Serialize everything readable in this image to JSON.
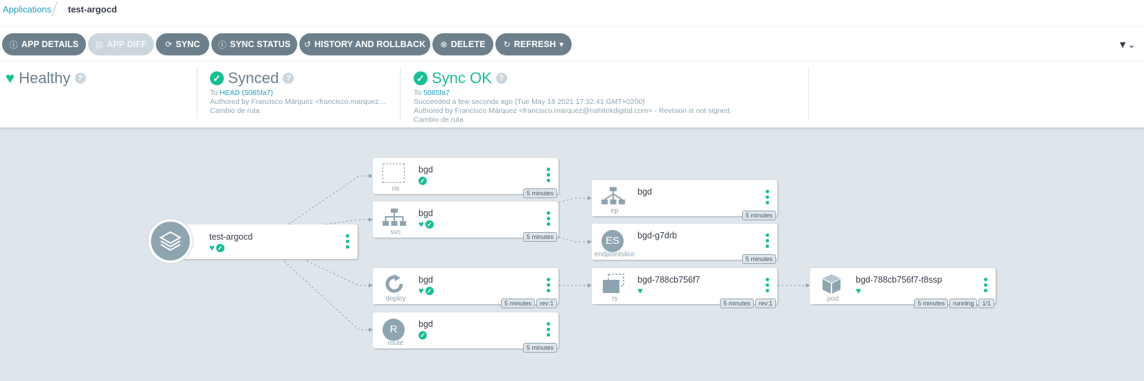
{
  "breadcrumb": {
    "root": "Applications",
    "current": "test-argocd"
  },
  "toolbar": {
    "app_details": "APP DETAILS",
    "app_diff": "APP DIFF",
    "sync": "SYNC",
    "sync_status": "SYNC STATUS",
    "history": "HISTORY AND ROLLBACK",
    "delete": "DELETE",
    "refresh": "REFRESH"
  },
  "health": {
    "title": "Healthy"
  },
  "sync": {
    "title": "Synced",
    "to_prefix": "To",
    "to_rev": "HEAD (5085fa7)",
    "author": "Authored by Francisco Márquez <francisco.marquez…",
    "message": "Cambio de ruta"
  },
  "operation": {
    "title": "Sync OK",
    "to_prefix": "To",
    "to_rev": "5085fa7",
    "succeeded": "Succeeded a few seconds ago (Tue May 18 2021 17:32:41 GMT+0200)",
    "author": "Authored by Francisco Márquez <francisco.marquez@nahitekdigital.com> - Revision is not signed.",
    "message": "Cambio de ruta"
  },
  "colors": {
    "accent": "#18be94",
    "button": "#6d7f8b",
    "button_disabled": "#ccd6dd",
    "graph_bg": "#dee6eb",
    "link": "#1a9fc0"
  },
  "graph": {
    "app": {
      "name": "test-argocd"
    },
    "ns": {
      "name": "bgd",
      "kind": "ns",
      "age": "5 minutes"
    },
    "svc": {
      "name": "bgd",
      "kind": "svc",
      "age": "5 minutes"
    },
    "deploy": {
      "name": "bgd",
      "kind": "deploy",
      "age": "5 minutes",
      "rev": "rev:1"
    },
    "route": {
      "name": "bgd",
      "kind": "route",
      "age": "5 minutes",
      "badge": "R"
    },
    "ep": {
      "name": "bgd",
      "kind": "ep",
      "age": "5 minutes"
    },
    "es": {
      "name": "bgd-g7drb",
      "kind": "endpointslice",
      "age": "5 minutes",
      "badge": "ES"
    },
    "rs": {
      "name": "bgd-788cb756f7",
      "kind": "rs",
      "age": "5 minutes",
      "rev": "rev:1"
    },
    "pod": {
      "name": "bgd-788cb756f7-t8ssp",
      "kind": "pod",
      "age": "5 minutes",
      "status": "running",
      "ready": "1/1"
    }
  }
}
